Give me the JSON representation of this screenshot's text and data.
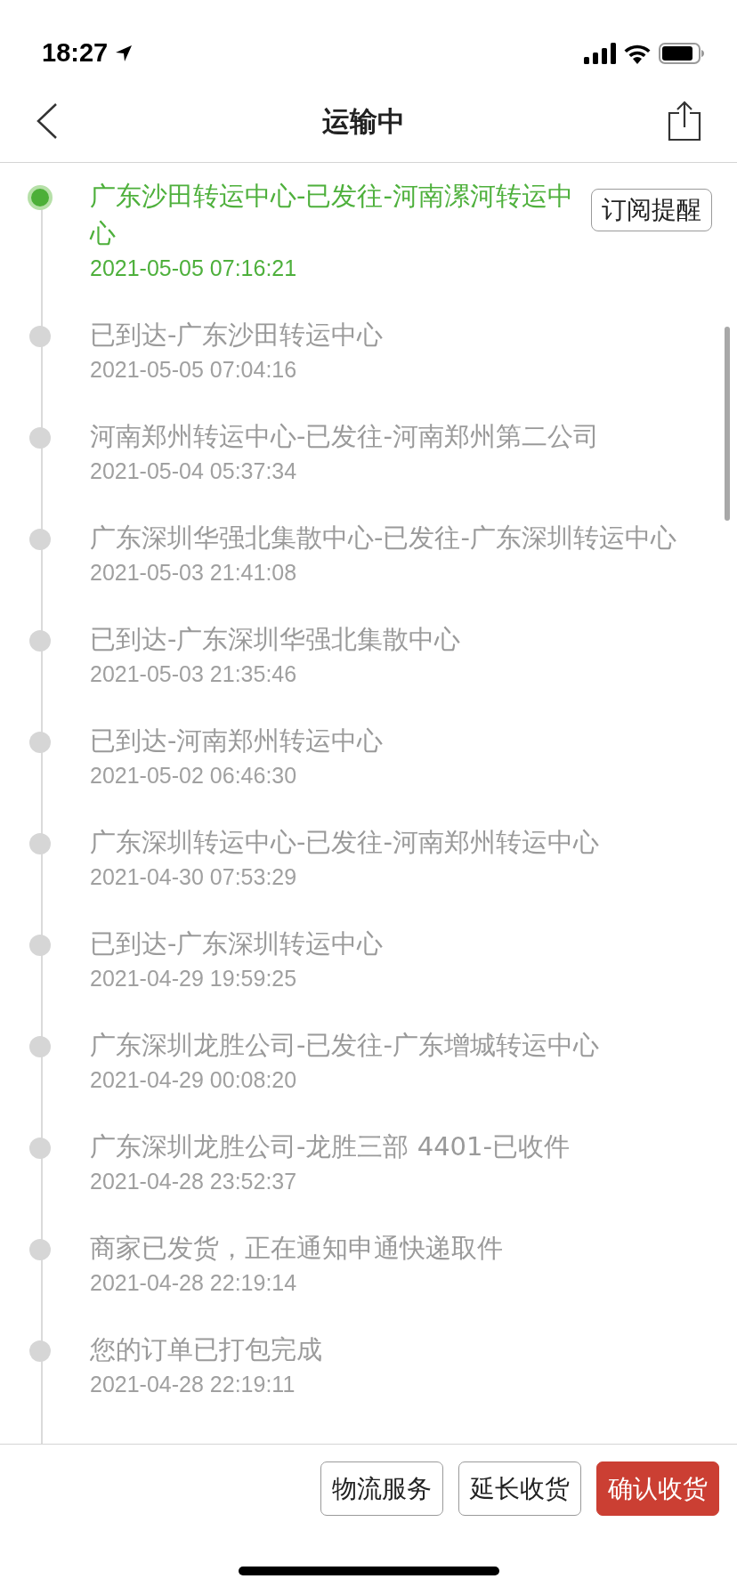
{
  "status_bar": {
    "time": "18:27"
  },
  "nav": {
    "title": "运输中"
  },
  "subscribe_button": "订阅提醒",
  "tracking": [
    {
      "text": "广东沙田转运中心-已发往-河南漯河转运中心",
      "time": "2021-05-05 07:16:21",
      "current": true
    },
    {
      "text": "已到达-广东沙田转运中心",
      "time": "2021-05-05 07:04:16",
      "current": false
    },
    {
      "text": "河南郑州转运中心-已发往-河南郑州第二公司",
      "time": "2021-05-04 05:37:34",
      "current": false
    },
    {
      "text": "广东深圳华强北集散中心-已发往-广东深圳转运中心",
      "time": "2021-05-03 21:41:08",
      "current": false
    },
    {
      "text": "已到达-广东深圳华强北集散中心",
      "time": "2021-05-03 21:35:46",
      "current": false
    },
    {
      "text": "已到达-河南郑州转运中心",
      "time": "2021-05-02 06:46:30",
      "current": false
    },
    {
      "text": "广东深圳转运中心-已发往-河南郑州转运中心",
      "time": "2021-04-30 07:53:29",
      "current": false
    },
    {
      "text": "已到达-广东深圳转运中心",
      "time": "2021-04-29 19:59:25",
      "current": false
    },
    {
      "text": "广东深圳龙胜公司-已发往-广东增城转运中心",
      "time": "2021-04-29 00:08:20",
      "current": false
    },
    {
      "text": "广东深圳龙胜公司-龙胜三部 4401-已收件",
      "time": "2021-04-28 23:52:37",
      "current": false
    },
    {
      "text": "商家已发货，正在通知申通快递取件",
      "time": "2021-04-28 22:19:14",
      "current": false
    },
    {
      "text": "您的订单已打包完成",
      "time": "2021-04-28 22:19:11",
      "current": false
    }
  ],
  "footer_buttons": [
    {
      "label": "物流服务",
      "primary": false
    },
    {
      "label": "延长收货",
      "primary": false
    },
    {
      "label": "确认收货",
      "primary": true
    }
  ]
}
